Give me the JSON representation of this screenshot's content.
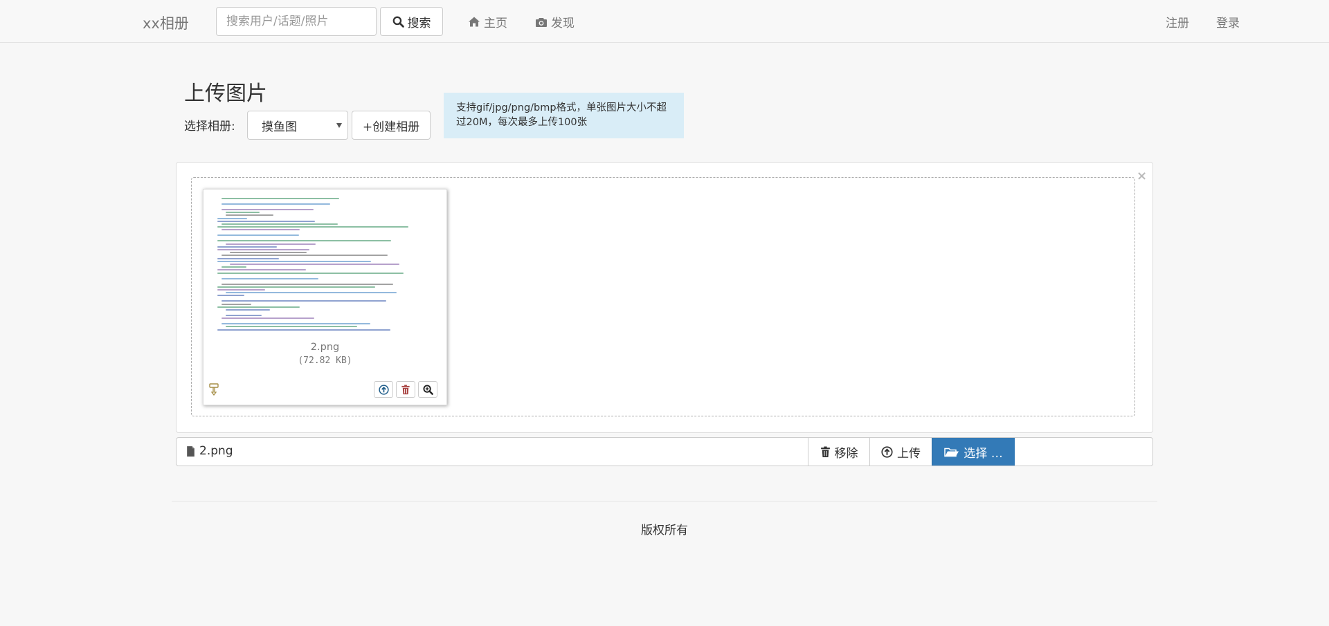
{
  "nav": {
    "brand": "xx相册",
    "search": {
      "placeholder": "搜索用户/话题/照片",
      "button_label": "搜索",
      "icon": "search-icon"
    },
    "links": {
      "home": "主页",
      "discover": "发现",
      "register": "注册",
      "login": "登录"
    },
    "icons": {
      "home": "home-icon",
      "discover": "camera-icon"
    }
  },
  "upload": {
    "title": "上传图片",
    "album_label": "选择相册:",
    "album_selected": "摸鱼图",
    "create_album_label": "+创建相册",
    "info_text": "支持gif/jpg/png/bmp格式，单张图片大小不超过20M，每次最多上传100张"
  },
  "preview": {
    "filename": "2.png",
    "size": "(72.82 KB)",
    "actions": [
      "upload-icon",
      "trash-icon",
      "zoom-icon"
    ],
    "close_glyph": "×"
  },
  "file_bar": {
    "caption": "2.png",
    "remove_label": "移除",
    "upload_label": "上传",
    "browse_label": "选择 …"
  },
  "colors": {
    "primary": "#337ab7",
    "info_bg": "#d9edf7",
    "danger": "#a94442"
  },
  "footer": {
    "text": "版权所有"
  }
}
